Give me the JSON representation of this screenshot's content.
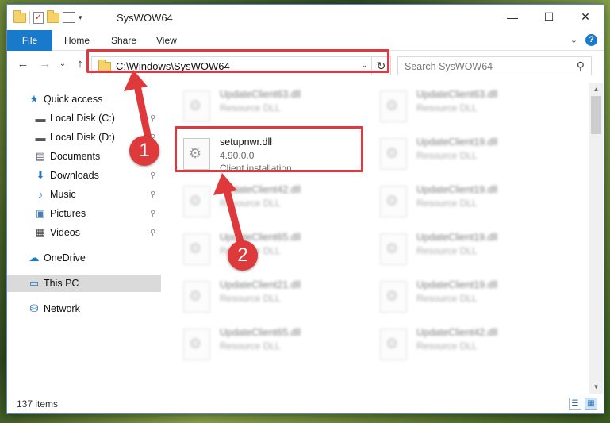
{
  "window": {
    "title": "SysWOW64",
    "controls": {
      "minimize": "—",
      "maximize": "☐",
      "close": "✕"
    }
  },
  "ribbon": {
    "tabs": [
      "File",
      "Home",
      "Share",
      "View"
    ],
    "help": "?",
    "expand": "⌄"
  },
  "nav": {
    "back": "←",
    "forward": "→",
    "recent": "⌄",
    "up": "↑",
    "address": "C:\\Windows\\SysWOW64",
    "address_dropdown": "⌄",
    "refresh": "↻",
    "search_placeholder": "Search SysWOW64",
    "search_icon": "⚲"
  },
  "sidebar": {
    "items": [
      {
        "label": "Quick access",
        "icon": "star-icon",
        "glyph": "★",
        "pinned": false
      },
      {
        "label": "Local Disk (C:)",
        "icon": "drive-icon",
        "glyph": "▬",
        "pinned": true
      },
      {
        "label": "Local Disk (D:)",
        "icon": "drive-icon",
        "glyph": "▬",
        "pinned": true
      },
      {
        "label": "Documents",
        "icon": "documents-icon",
        "glyph": "▤",
        "pinned": true
      },
      {
        "label": "Downloads",
        "icon": "downloads-icon",
        "glyph": "⬇",
        "pinned": true
      },
      {
        "label": "Music",
        "icon": "music-icon",
        "glyph": "♪",
        "pinned": true
      },
      {
        "label": "Pictures",
        "icon": "pictures-icon",
        "glyph": "▣",
        "pinned": true
      },
      {
        "label": "Videos",
        "icon": "videos-icon",
        "glyph": "▦",
        "pinned": true
      },
      {
        "label": "OneDrive",
        "icon": "cloud-icon",
        "glyph": "☁",
        "pinned": false
      },
      {
        "label": "This PC",
        "icon": "computer-icon",
        "glyph": "▭",
        "pinned": false
      },
      {
        "label": "Network",
        "icon": "network-icon",
        "glyph": "⛁",
        "pinned": false
      }
    ],
    "pin_glyph": "📌"
  },
  "files": {
    "highlighted": {
      "name": "setupnwr.dll",
      "version": "4.90.0.0",
      "description": "Client installation..."
    },
    "left_column": [
      {
        "name": "UpdateClient63.dll",
        "type": "Resource DLL"
      },
      {
        "name": "UpdateClient42.dll",
        "type": "Resource DLL"
      },
      {
        "name": "UpdateClient65.dll",
        "type": "Resource DLL"
      },
      {
        "name": "UpdateClient21.dll",
        "type": "Resource DLL"
      },
      {
        "name": "UpdateClient65.dll",
        "type": "Resource DLL"
      }
    ],
    "right_column": [
      {
        "name": "UpdateClient63.dll",
        "type": "Resource DLL"
      },
      {
        "name": "UpdateClient19.dll",
        "type": "Resource DLL"
      },
      {
        "name": "UpdateClient19.dll",
        "type": "Resource DLL"
      },
      {
        "name": "UpdateClient19.dll",
        "type": "Resource DLL"
      },
      {
        "name": "UpdateClient19.dll",
        "type": "Resource DLL"
      },
      {
        "name": "UpdateClient42.dll",
        "type": "Resource DLL"
      }
    ]
  },
  "status": {
    "items": "137 items"
  },
  "callouts": {
    "one": "1",
    "two": "2"
  },
  "colors": {
    "accent": "#1979ca",
    "highlight": "#e0383e"
  }
}
